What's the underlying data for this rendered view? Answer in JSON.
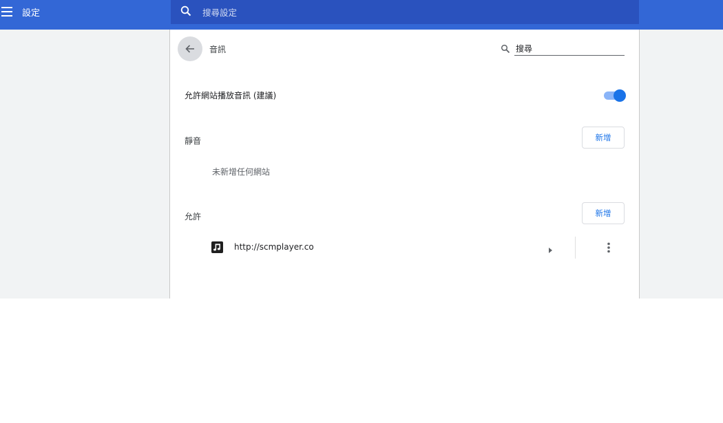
{
  "header": {
    "title": "設定",
    "search_placeholder": "搜尋設定",
    "color": "#3367d6"
  },
  "page": {
    "title": "音訊",
    "search_value": "搜尋",
    "allow_label": "允許網站播放音訊 (建議)",
    "allow_enabled": true,
    "accent": "#1a73e8"
  },
  "mute_section": {
    "label": "靜音",
    "add_label": "新增",
    "empty_message": "未新增任何網站"
  },
  "allow_section": {
    "label": "允許",
    "add_label": "新增",
    "sites": [
      {
        "url": "http://scmplayer.co",
        "icon": "music-note-icon"
      }
    ]
  },
  "icons": {
    "menu": "hamburger-menu-icon",
    "search": "search-icon",
    "back": "back-arrow-icon",
    "expand": "arrow-right-icon",
    "more": "more-vert-icon"
  }
}
